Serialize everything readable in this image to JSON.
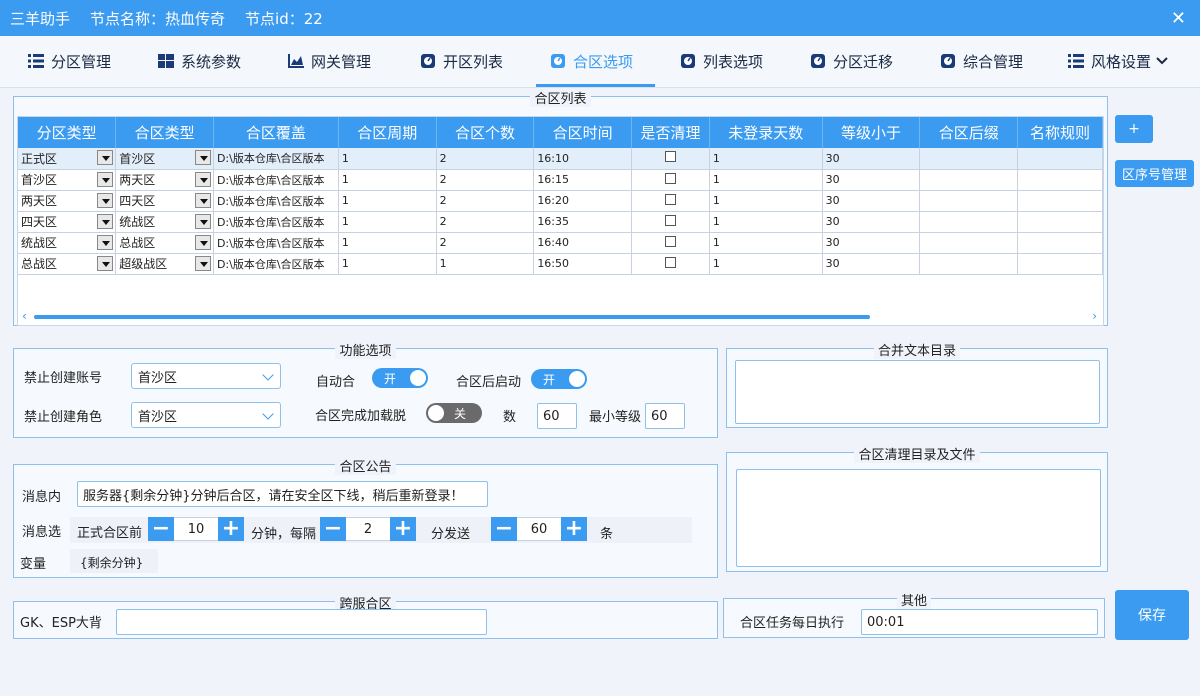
{
  "title": {
    "app": "三羊助手",
    "node_name": "节点名称：热血传奇",
    "node_id": "节点id：22"
  },
  "tabs": [
    {
      "label": "分区管理",
      "icon": "list-icon"
    },
    {
      "label": "系统参数",
      "icon": "windows-icon"
    },
    {
      "label": "网关管理",
      "icon": "chart-icon"
    },
    {
      "label": "开区列表",
      "icon": "gauge-icon"
    },
    {
      "label": "合区选项",
      "icon": "gauge-icon"
    },
    {
      "label": "列表选项",
      "icon": "gauge-icon"
    },
    {
      "label": "分区迁移",
      "icon": "gauge-icon"
    },
    {
      "label": "综合管理",
      "icon": "gauge-icon"
    },
    {
      "label": "风格设置",
      "icon": "list-icon"
    }
  ],
  "merge_list": {
    "legend": "合区列表",
    "headers": [
      "分区类型",
      "合区类型",
      "合区覆盖",
      "合区周期",
      "合区个数",
      "合区时间",
      "是否清理",
      "未登录天数",
      "等级小于",
      "合区后缀",
      "名称规则"
    ],
    "rows": [
      {
        "zone_type": "正式区",
        "merge_type": "首沙区",
        "cover": "D:\\版本仓库\\合区版本",
        "period": "1",
        "count": "2",
        "time": "16:10",
        "days": "1",
        "level": "30"
      },
      {
        "zone_type": "首沙区",
        "merge_type": "两天区",
        "cover": "D:\\版本仓库\\合区版本",
        "period": "1",
        "count": "2",
        "time": "16:15",
        "days": "1",
        "level": "30"
      },
      {
        "zone_type": "两天区",
        "merge_type": "四天区",
        "cover": "D:\\版本仓库\\合区版本",
        "period": "1",
        "count": "2",
        "time": "16:20",
        "days": "1",
        "level": "30"
      },
      {
        "zone_type": "四天区",
        "merge_type": "统战区",
        "cover": "D:\\版本仓库\\合区版本",
        "period": "1",
        "count": "2",
        "time": "16:35",
        "days": "1",
        "level": "30"
      },
      {
        "zone_type": "统战区",
        "merge_type": "总战区",
        "cover": "D:\\版本仓库\\合区版本",
        "period": "1",
        "count": "2",
        "time": "16:40",
        "days": "1",
        "level": "30"
      },
      {
        "zone_type": "总战区",
        "merge_type": "超级战区",
        "cover": "D:\\版本仓库\\合区版本",
        "period": "1",
        "count": "1",
        "time": "16:50",
        "days": "1",
        "level": "30"
      }
    ]
  },
  "side_buttons": {
    "add": "+",
    "seq_manage": "区序号管理",
    "save": "保存"
  },
  "function_options": {
    "legend": "功能选项",
    "ban_account_label": "禁止创建账号",
    "ban_account_value": "首沙区",
    "ban_role_label": "禁止创建角色",
    "ban_role_value": "首沙区",
    "auto_merge_label": "自动合",
    "auto_merge_state": "开",
    "start_after_label": "合区后启动",
    "start_after_state": "开",
    "load_off_label": "合区完成加载脱",
    "load_off_state": "关",
    "count_label": "数",
    "count_value": "60",
    "min_level_label": "最小等级",
    "min_level_value": "60"
  },
  "merge_text_dir": {
    "legend": "合并文本目录"
  },
  "cleanup_dir": {
    "legend": "合区清理目录及文件"
  },
  "announcement": {
    "legend": "合区公告",
    "message_label": "消息内",
    "message_value": "服务器{剩余分钟}分钟后合区，请在安全区下线，稍后重新登录！",
    "option_label": "消息选",
    "before_label": "正式合区前",
    "before_value": "10",
    "minute_every_label": "分钟，每隔",
    "interval_value": "2",
    "send_label": "分发送",
    "count_value": "60",
    "unit_label": "条",
    "variable_label": "变量",
    "variable_value": "{剩余分钟}"
  },
  "cross_server": {
    "legend": "跨服合区",
    "label": "GK、ESP大背",
    "value": ""
  },
  "other": {
    "legend": "其他",
    "label": "合区任务每日执行",
    "value": "00:01"
  },
  "colors": {
    "accent": "#3a9bf0"
  }
}
